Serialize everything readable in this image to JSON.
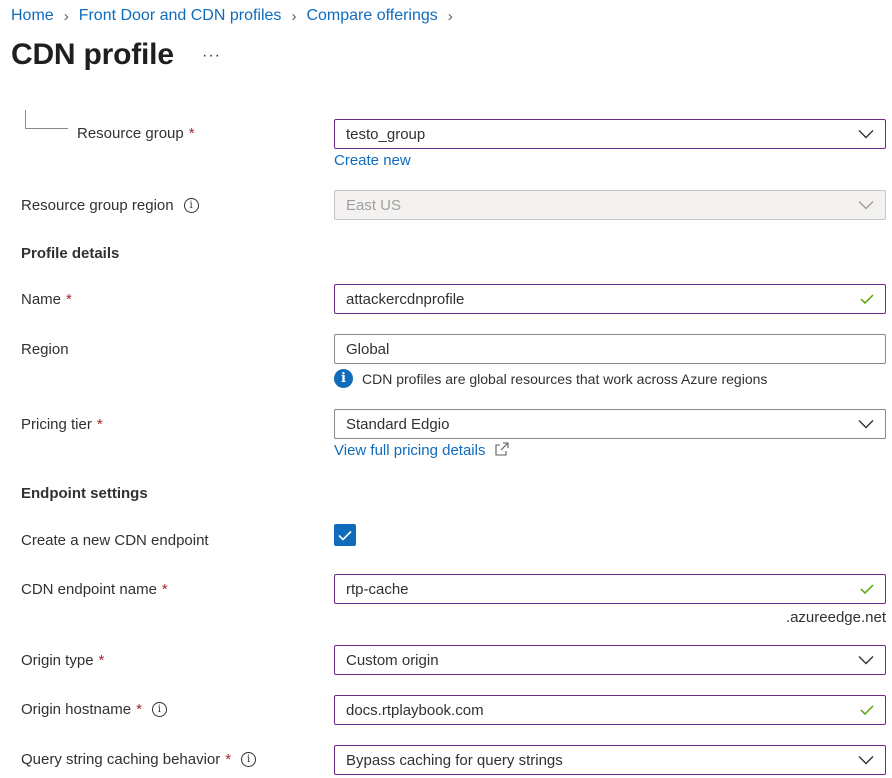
{
  "breadcrumb": {
    "items": [
      "Home",
      "Front Door and CDN profiles",
      "Compare offerings"
    ]
  },
  "page": {
    "title": "CDN profile",
    "more": "···"
  },
  "resource_group": {
    "label": "Resource group",
    "required": "*",
    "value": "testo_group",
    "create_new": "Create new"
  },
  "resource_group_region": {
    "label": "Resource group region",
    "info": "i",
    "value": "East US"
  },
  "profile_details": {
    "heading": "Profile details",
    "name": {
      "label": "Name",
      "required": "*",
      "value": "attackercdnprofile"
    },
    "region": {
      "label": "Region",
      "value": "Global",
      "note": "CDN profiles are global resources that work across Azure regions",
      "note_icon": "i"
    },
    "pricing_tier": {
      "label": "Pricing tier",
      "required": "*",
      "value": "Standard Edgio",
      "link": "View full pricing details"
    }
  },
  "endpoint_settings": {
    "heading": "Endpoint settings",
    "create_endpoint": {
      "label": "Create a new CDN endpoint",
      "checked": true
    },
    "endpoint_name": {
      "label": "CDN endpoint name",
      "required": "*",
      "value": "rtp-cache",
      "suffix": ".azureedge.net"
    },
    "origin_type": {
      "label": "Origin type",
      "required": "*",
      "value": "Custom origin"
    },
    "origin_hostname": {
      "label": "Origin hostname",
      "required": "*",
      "info": "i",
      "value": "docs.rtplaybook.com"
    },
    "query_string": {
      "label": "Query string caching behavior",
      "required": "*",
      "info": "i",
      "value": "Bypass caching for query strings"
    }
  },
  "colors": {
    "link": "#0f6cbd",
    "required": "#a4262c",
    "valid_check": "#57a300",
    "focus_border": "#6b2a84",
    "checkbox": "#0f6cbd"
  },
  "icons": {
    "dropdown": "chevron-down-icon",
    "valid": "checkmark-icon",
    "info": "info-icon",
    "external": "external-link-icon"
  }
}
